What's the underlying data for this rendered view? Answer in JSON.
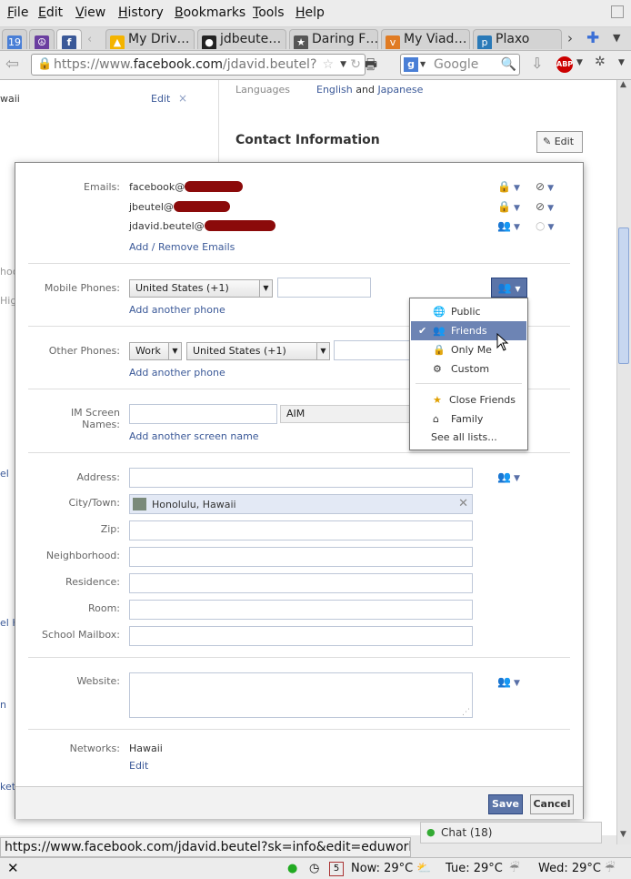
{
  "menubar": {
    "items": [
      {
        "label": "File",
        "u": "F",
        "rest": "ile"
      },
      {
        "label": "Edit",
        "u": "E",
        "rest": "dit"
      },
      {
        "label": "View",
        "u": "V",
        "rest": "iew"
      },
      {
        "label": "History",
        "u": "H",
        "rest": "istory"
      },
      {
        "label": "Bookmarks",
        "u": "B",
        "rest": "ookmarks"
      },
      {
        "label": "Tools",
        "u": "T",
        "rest": "ools"
      },
      {
        "label": "Help",
        "u": "H",
        "rest": "elp"
      }
    ]
  },
  "tabs": [
    {
      "title": "My Driv…",
      "icon": "google-drive-icon"
    },
    {
      "title": "jdbeute…",
      "icon": "github-icon"
    },
    {
      "title": "Daring F…",
      "icon": "star-icon"
    },
    {
      "title": "My Viad…",
      "icon": "viadeo-icon"
    },
    {
      "title": "Plaxo",
      "icon": "plaxo-icon"
    }
  ],
  "calendar_day": "19",
  "nav": {
    "url_prefix": "https://www.",
    "url_host": "facebook.com",
    "url_path": "/jdavid.beutel?",
    "search_placeholder": "Google",
    "search_engine_letter": "g"
  },
  "background": {
    "location_text": "waii",
    "edit_link": "Edit",
    "close_mark": "×",
    "languages_label": "Languages",
    "lang1": "English",
    "and_word": "and",
    "lang2": "Japanese",
    "contact_title": "Contact Information",
    "edit_button": "Edit",
    "left_frag": [
      "hoo",
      "Hig",
      "el",
      "el H",
      "n",
      "ket"
    ]
  },
  "form": {
    "emails_label": "Emails:",
    "emails": [
      "facebook@",
      "jbeutel@",
      "jdavid.beutel@"
    ],
    "add_remove_emails": "Add / Remove Emails",
    "mobile_label": "Mobile Phones:",
    "mobile_country": "United States (+1)",
    "add_another_phone": "Add another phone",
    "other_label": "Other Phones:",
    "other_type": "Work",
    "other_country": "United States (+1)",
    "add_another_phone2": "Add another phone",
    "im_label_1": "IM Screen",
    "im_label_2": "Names:",
    "im_service": "AIM",
    "add_screen_name": "Add another screen name",
    "address_label": "Address:",
    "city_label": "City/Town:",
    "city_value": "Honolulu, Hawaii",
    "zip_label": "Zip:",
    "neighborhood_label": "Neighborhood:",
    "residence_label": "Residence:",
    "room_label": "Room:",
    "mailbox_label": "School Mailbox:",
    "website_label": "Website:",
    "networks_label": "Networks:",
    "networks_value": "Hawaii",
    "networks_edit": "Edit",
    "save": "Save",
    "cancel": "Cancel"
  },
  "audience_menu": {
    "items": [
      {
        "label": "Public",
        "icon": "globe-icon",
        "selected": false
      },
      {
        "label": "Friends",
        "icon": "friends-icon",
        "selected": true
      },
      {
        "label": "Only Me",
        "icon": "lock-icon",
        "selected": false
      },
      {
        "label": "Custom",
        "icon": "gear-icon",
        "selected": false
      },
      {
        "label": "Close Friends",
        "icon": "star-icon",
        "selected": false
      },
      {
        "label": "Family",
        "icon": "home-icon",
        "selected": false
      }
    ],
    "see_all": "See all lists..."
  },
  "status": {
    "url": "https://www.facebook.com/jdavid.beutel?sk=info&edit=eduwork#",
    "chat": "Chat (18)",
    "weather_now": "Now: 29°C",
    "weather_tue": "Tue: 29°C",
    "weather_wed": "Wed: 29°C",
    "cal_day": "5"
  },
  "colors": {
    "fb_blue": "#3b5998",
    "selected": "#6d84b4",
    "button": "#5b74a8"
  }
}
